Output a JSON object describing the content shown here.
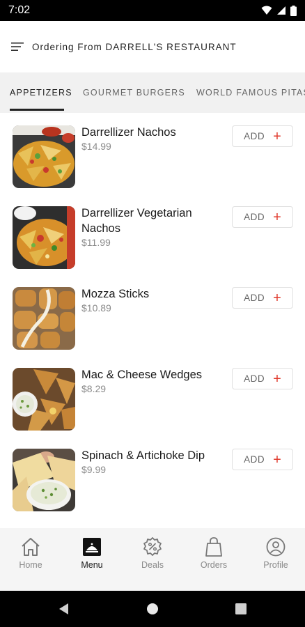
{
  "status_bar": {
    "time": "7:02"
  },
  "header": {
    "ordering_text": "Ordering From DARRELL'S RESTAURANT"
  },
  "tabs": [
    {
      "label": "APPETIZERS",
      "active": true
    },
    {
      "label": "GOURMET BURGERS",
      "active": false
    },
    {
      "label": "WORLD FAMOUS PITAS",
      "active": false
    }
  ],
  "menu_items": [
    {
      "name": "Darrellizer Nachos",
      "price": "$14.99",
      "add_label": "ADD"
    },
    {
      "name": "Darrellizer Vegetarian Nachos",
      "price": "$11.99",
      "add_label": "ADD"
    },
    {
      "name": "Mozza Sticks",
      "price": "$10.89",
      "add_label": "ADD"
    },
    {
      "name": "Mac & Cheese Wedges",
      "price": "$8.29",
      "add_label": "ADD"
    },
    {
      "name": "Spinach & Artichoke Dip",
      "price": "$9.99",
      "add_label": "ADD"
    }
  ],
  "bottom_nav": [
    {
      "label": "Home",
      "icon": "home-icon",
      "active": false
    },
    {
      "label": "Menu",
      "icon": "menu-tray-icon",
      "active": true
    },
    {
      "label": "Deals",
      "icon": "deals-badge-icon",
      "active": false
    },
    {
      "label": "Orders",
      "icon": "shopping-bag-icon",
      "active": false
    },
    {
      "label": "Profile",
      "icon": "profile-icon",
      "active": false
    }
  ],
  "colors": {
    "accent": "#e0392c",
    "tab_bar": "#f1f1f1",
    "bottom_nav": "#f5f5f5"
  }
}
